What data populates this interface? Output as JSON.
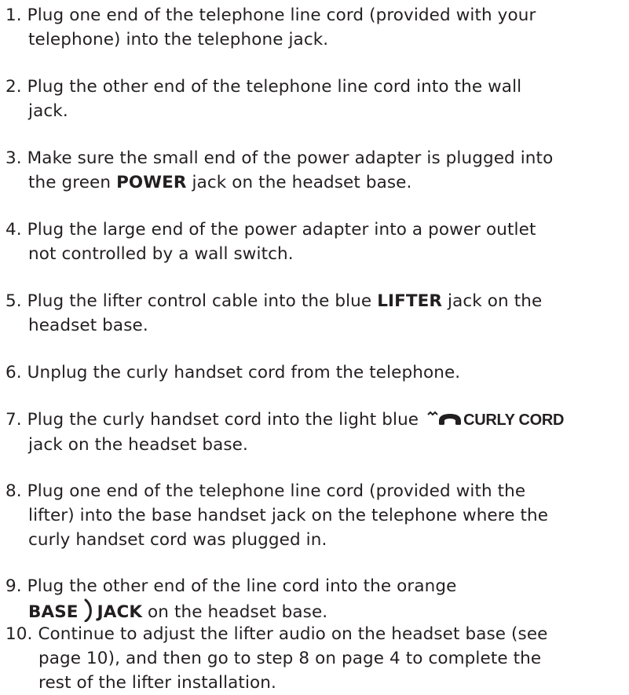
{
  "steps": [
    {
      "number": "1.",
      "line1": "Plug one end of the telephone line cord (provided with your",
      "line2": "telephone) into the telephone jack."
    },
    {
      "number": "2.",
      "line1": "Plug the other end of the telephone line cord into the wall",
      "line2": "jack."
    },
    {
      "number": "3.",
      "line1": "Make sure the small end of the power adapter is plugged into",
      "line2_pre": "the green ",
      "line2_bold": "POWER",
      "line2_post": " jack on the headset base."
    },
    {
      "number": "4.",
      "line1": "Plug the large end of the power adapter into a power outlet",
      "line2": "not controlled by a wall switch."
    },
    {
      "number": "5.",
      "line1_pre": "Plug the lifter control cable into the blue ",
      "line1_bold": "LIFTER",
      "line1_post": " jack on the",
      "line2": "headset base."
    },
    {
      "number": "6.",
      "line1": "Unplug the curly handset cord from the telephone."
    },
    {
      "number": "7.",
      "line1_pre": "Plug the curly handset cord into the light blue ",
      "line1_label": "CURLY CORD",
      "line2": "jack on the headset base.",
      "icon": "curly-handset-icon"
    },
    {
      "number": "8.",
      "line1": "Plug one end of the telephone line cord (provided with the",
      "line2": "lifter) into the base handset jack on the telephone where the",
      "line3": "curly handset cord was plugged in."
    },
    {
      "number": "9.",
      "line1": "Plug the other end of the line cord into the orange",
      "line2_bold_a": "BASE",
      "line2_bold_b": "JACK",
      "line2_post": " on the headset base.",
      "icon": "base-jack-icon"
    },
    {
      "number": "10.",
      "line1": "Continue to adjust the lifter audio on the headset base (see",
      "line2": "page 10), and then go to step 8 on page 4 to complete the",
      "line3": "rest of the lifter installation."
    }
  ],
  "colors": {
    "text": "#231f20"
  }
}
